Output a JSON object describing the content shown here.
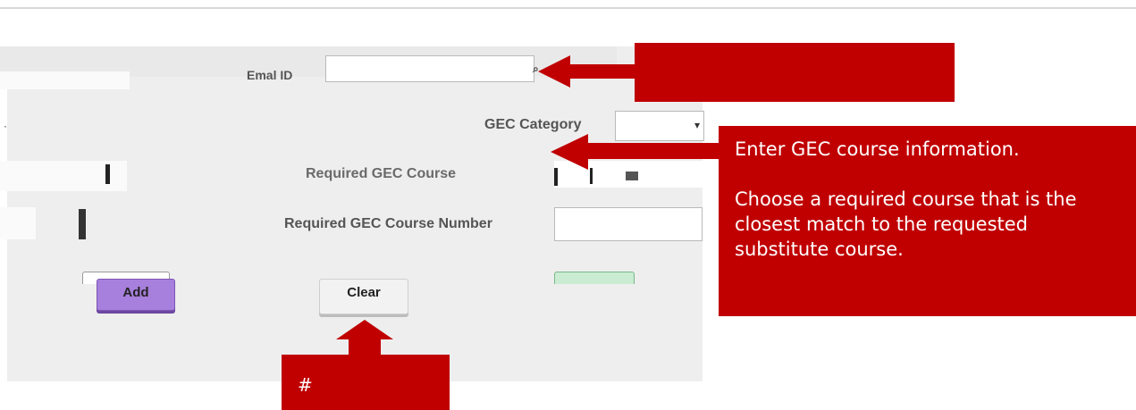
{
  "form": {
    "email_label": "Emal ID",
    "gec_category_label": "GEC Category",
    "req_course_label": "Required GEC Course",
    "req_course_number_label": "Required GEC Course Number",
    "email_value": "",
    "gec_category_value": "",
    "req_course_number_value": ""
  },
  "buttons": {
    "add_label": "Add",
    "clear_label": "Clear"
  },
  "callouts": {
    "email_hint": "",
    "gec_info_line1": "Enter GEC course information.",
    "gec_info_line2": "Choose a required course that is the closest match to the requested substitute course.",
    "clear_hint": "#"
  },
  "colors": {
    "callout": "#c00000",
    "panel": "#eeeeee",
    "add_button": "#a77fdc"
  }
}
